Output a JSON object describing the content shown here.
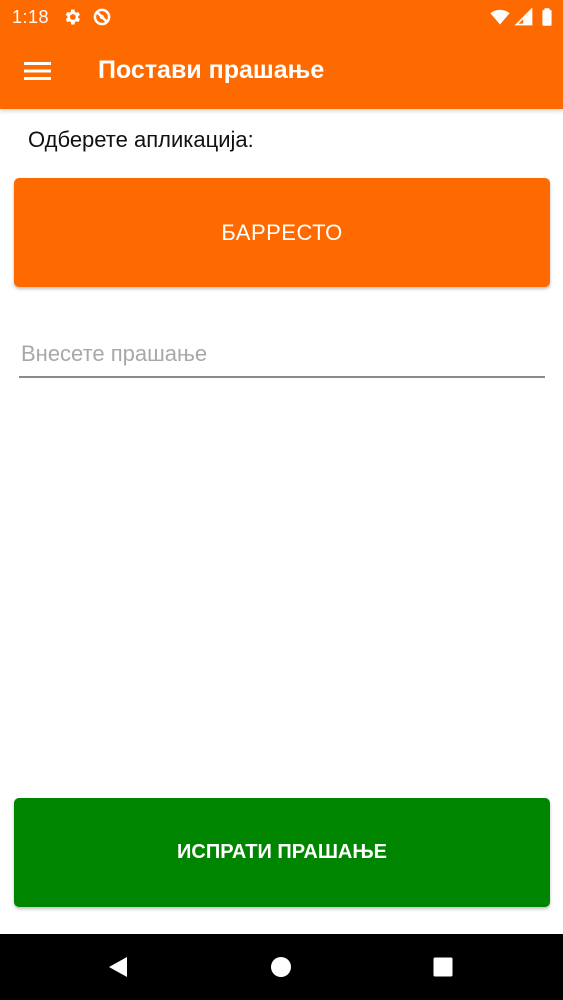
{
  "status_bar": {
    "time": "1:18",
    "icons": [
      "settings-icon",
      "no-disturb-icon",
      "wifi-icon",
      "signal-icon",
      "battery-icon"
    ]
  },
  "app_bar": {
    "title": "Постави прашање",
    "menu_icon": "hamburger-menu-icon"
  },
  "form": {
    "choose_label": "Одберете апликација:",
    "selected_app": "БАРРЕСТО",
    "question_placeholder": "Внесете прашање",
    "question_value": "",
    "send_label": "ИСПРАТИ ПРАШАЊЕ"
  },
  "nav_bar": {
    "icons": [
      "back-icon",
      "home-icon",
      "recents-icon"
    ]
  },
  "colors": {
    "primary": "#ff6a00",
    "send_button": "#008500",
    "nav_bar": "#000000",
    "input_underline": "#8a8a8a",
    "placeholder": "#a8a8a8"
  }
}
